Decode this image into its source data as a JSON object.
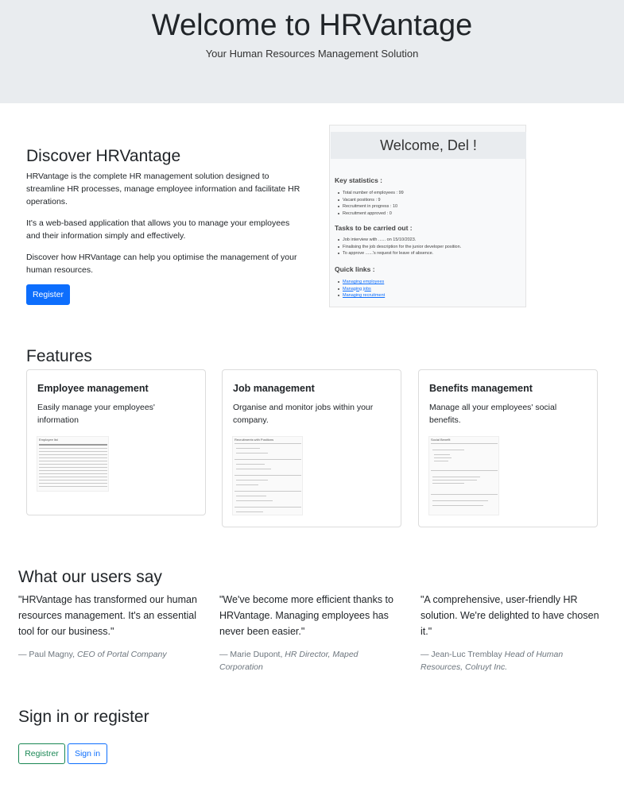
{
  "hero": {
    "title": "Welcome to HRVantage",
    "subtitle": "Your Human Resources Management Solution"
  },
  "discover": {
    "title": "Discover HRVantage",
    "paragraphs": [
      "HRVantage is the complete HR management solution designed to streamline HR processes, manage employee information and facilitate HR operations.",
      "It's a web-based application that allows you to manage your employees and their information simply and effectively.",
      "Discover how HRVantage can help you optimise the management of your human resources."
    ],
    "register_label": "Register"
  },
  "preview": {
    "heading": "Welcome, Del !",
    "key_stats_title": "Key statistics :",
    "key_stats": [
      "Total number of employees : 99",
      "Vacant positions : 9",
      "Recruitment in progress : 10",
      "Recruitment approved : 0"
    ],
    "tasks_title": "Tasks to be carried out :",
    "tasks": [
      "Job interview with ...... on 15/10/2023.",
      "Finalising the job description for the junior developer position.",
      "To approve ......'s request for leave of absence."
    ],
    "links_title": "Quick links :",
    "links": [
      "Managing employees",
      "Managing jobs",
      "Managing recruitment"
    ]
  },
  "features": {
    "title": "Features",
    "cards": [
      {
        "title": "Employee management",
        "text": "Easily manage your employees' information",
        "thumb_title": "Employee list"
      },
      {
        "title": "Job management",
        "text": "Organise and monitor jobs within your company.",
        "thumb_title": "Recruitments with Positions"
      },
      {
        "title": "Benefits management",
        "text": "Manage all your employees' social benefits.",
        "thumb_title": "Social Benefit"
      }
    ]
  },
  "testimonials": {
    "title": "What our users say",
    "items": [
      {
        "quote": "\"HRVantage has transformed our human resources management. It's an essential tool for our business.\"",
        "author": "— Paul Magny,",
        "role": "CEO of Portal Company"
      },
      {
        "quote": "\"We've become more efficient thanks to HRVantage. Managing employees has never been easier.\"",
        "author": "— Marie Dupont,",
        "role": "HR Director, Maped Corporation"
      },
      {
        "quote": "\"A comprehensive, user-friendly HR solution. We're delighted to have chosen it.\"",
        "author": "— Jean-Luc Tremblay",
        "role": "Head of Human Resources, Colruyt Inc."
      }
    ]
  },
  "signin": {
    "title": "Sign in or register",
    "register_label": "Registrer",
    "signin_label": "Sign in"
  },
  "colors": {
    "primary": "#0d6efd",
    "success": "#198754",
    "hero_bg": "#e9ecef"
  }
}
